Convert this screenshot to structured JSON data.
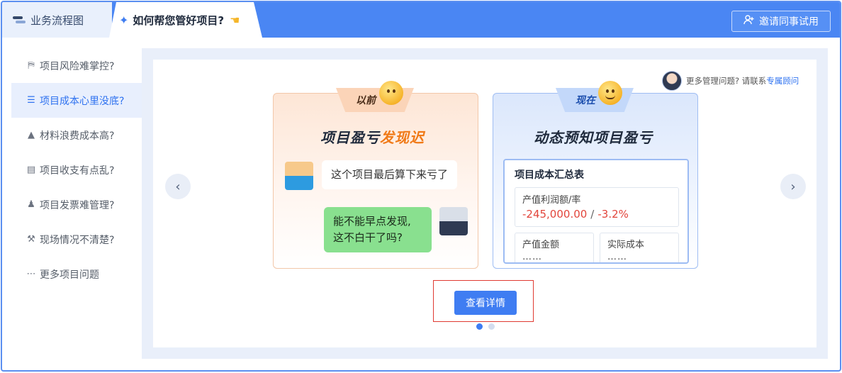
{
  "tabs": [
    {
      "label": "业务流程图",
      "icon": "flow-icon"
    },
    {
      "label": "如何帮您管好项目?",
      "icon": "sparkle-icon",
      "trail_icon": "pointing-hand-icon"
    }
  ],
  "invite_button": {
    "label": "邀请同事试用",
    "icon": "add-user-icon"
  },
  "sidebar": {
    "items": [
      {
        "label": "项目风险难掌控?",
        "icon": "risk-icon"
      },
      {
        "label": "项目成本心里没底?",
        "icon": "coins-icon"
      },
      {
        "label": "材料浪费成本高?",
        "icon": "materials-icon"
      },
      {
        "label": "项目收支有点乱?",
        "icon": "ledger-icon"
      },
      {
        "label": "项目发票难管理?",
        "icon": "invoice-icon"
      },
      {
        "label": "现场情况不清楚?",
        "icon": "site-worker-icon"
      },
      {
        "label": "更多项目问题",
        "icon": "more-icon"
      }
    ],
    "active_index": 1
  },
  "advisor": {
    "text": "更多管理问题? 请联系",
    "link": "专属顾问"
  },
  "before": {
    "badge": "以前",
    "title_main": "项目盈亏",
    "title_highlight": "发现迟",
    "bubble_a": "这个项目最后算下来亏了",
    "bubble_b_line1": "能不能早点发现,",
    "bubble_b_line2": "这不白干了吗?"
  },
  "now": {
    "badge": "现在",
    "title": "动态预知项目盈亏",
    "summary_title": "项目成本汇总表",
    "kpi_label": "产值利润额/率",
    "kpi_amount": "-245,000.00",
    "kpi_separator": "/",
    "kpi_rate": "-3.2%",
    "cell_a_label": "产值金额",
    "cell_b_label": "实际成本",
    "ellipsis": "……"
  },
  "detail_button": {
    "label": "查看详情"
  },
  "carousel": {
    "count": 2,
    "active": 0
  },
  "nav": {
    "prev": "‹",
    "next": "›"
  },
  "colors": {
    "brand": "#4a86f3",
    "accent_orange": "#f07a18",
    "loss_red": "#e2453b",
    "chat_green": "#89e08f"
  }
}
